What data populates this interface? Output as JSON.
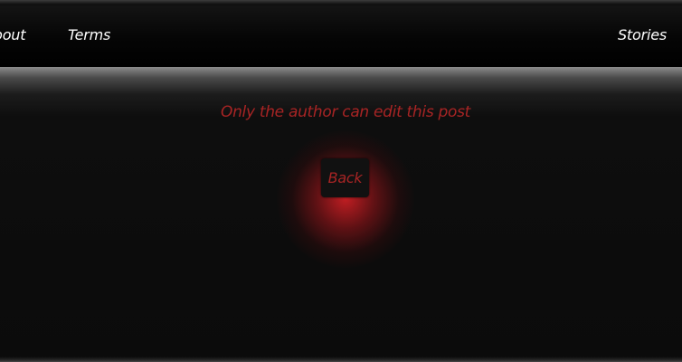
{
  "nav": {
    "about_label": "About",
    "terms_label": "Terms",
    "stories_label": "Stories"
  },
  "main": {
    "message": "Only the author can edit this post",
    "back_label": "Back"
  },
  "colors": {
    "accent_red": "#a82424",
    "background": "#0a0a0a",
    "nav_text": "#ffffff"
  }
}
